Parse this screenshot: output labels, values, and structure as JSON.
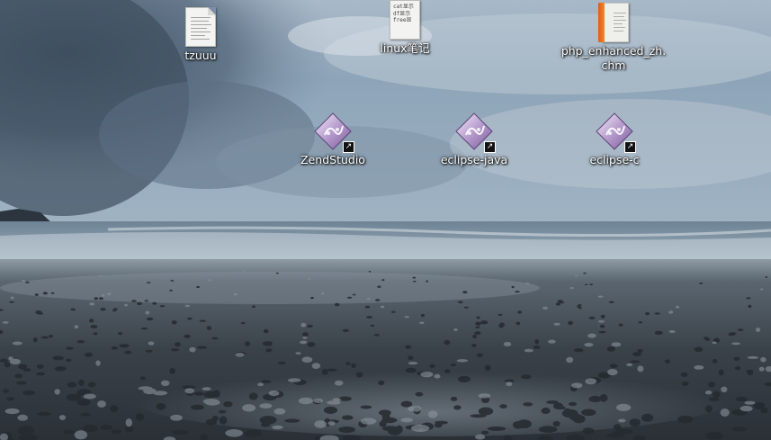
{
  "desktop": {
    "icons": [
      {
        "label": "tzuuu",
        "kind": "text-document-icon"
      },
      {
        "label": "linux笔记",
        "kind": "text-document-preview-icon",
        "preview": "cat显示\ndf显示\nfree显"
      },
      {
        "label": "php_enhanced_zh.\nchm",
        "kind": "chm-document-icon"
      },
      {
        "label": "ZendStudio",
        "kind": "eclipse-launcher-icon"
      },
      {
        "label": "eclipse-java",
        "kind": "eclipse-launcher-icon"
      },
      {
        "label": "eclipse-c",
        "kind": "eclipse-launcher-icon"
      }
    ],
    "launcher_badge": "shortcut-arrow-icon",
    "colors": {
      "sky": "#8da3b8",
      "sea": "#5f7483",
      "beach": "#3b4148",
      "launcher_purple": "#9a7bb4",
      "chm_orange": "#ea6f1c"
    }
  }
}
